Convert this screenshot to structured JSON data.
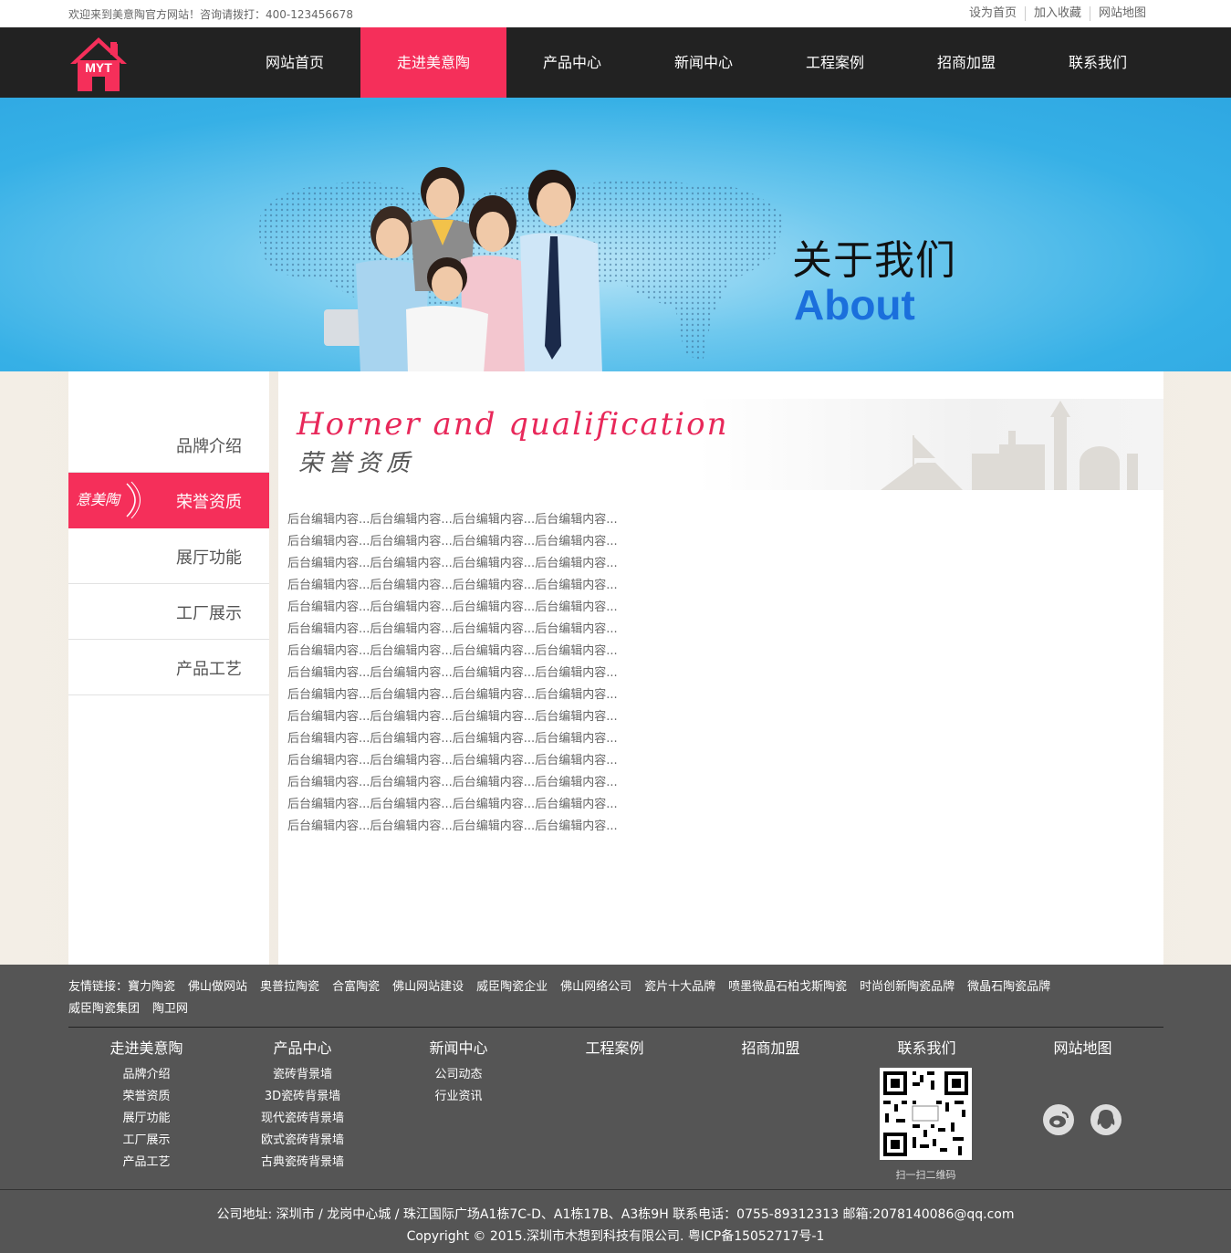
{
  "topbar": {
    "welcome": "欢迎来到美意陶官方网站！咨询请拨打：400-123456678",
    "links": [
      "设为首页",
      "加入收藏",
      "网站地图"
    ]
  },
  "header": {
    "logo_text": "MYT",
    "nav": [
      "网站首页",
      "走进美意陶",
      "产品中心",
      "新闻中心",
      "工程案例",
      "招商加盟",
      "联系我们"
    ],
    "active_index": 1,
    "accent_color": "#f52f5a"
  },
  "banner": {
    "title_cn": "关于我们",
    "title_en": "About"
  },
  "sidebar": {
    "items": [
      "品牌介绍",
      "荣誉资质",
      "展厅功能",
      "工厂展示",
      "产品工艺"
    ],
    "active_index": 1,
    "active_mark": "意美陶"
  },
  "main": {
    "heading_en": "Horner and qualification",
    "heading_cn": "荣誉资质",
    "lines": [
      "后台编辑内容...后台编辑内容...后台编辑内容...后台编辑内容...",
      "后台编辑内容...后台编辑内容...后台编辑内容...后台编辑内容...",
      "后台编辑内容...后台编辑内容...后台编辑内容...后台编辑内容...",
      "后台编辑内容...后台编辑内容...后台编辑内容...后台编辑内容...",
      "后台编辑内容...后台编辑内容...后台编辑内容...后台编辑内容...",
      "后台编辑内容...后台编辑内容...后台编辑内容...后台编辑内容...",
      "后台编辑内容...后台编辑内容...后台编辑内容...后台编辑内容...",
      "后台编辑内容...后台编辑内容...后台编辑内容...后台编辑内容...",
      "后台编辑内容...后台编辑内容...后台编辑内容...后台编辑内容...",
      "后台编辑内容...后台编辑内容...后台编辑内容...后台编辑内容...",
      "后台编辑内容...后台编辑内容...后台编辑内容...后台编辑内容...",
      "后台编辑内容...后台编辑内容...后台编辑内容...后台编辑内容...",
      "后台编辑内容...后台编辑内容...后台编辑内容...后台编辑内容...",
      "后台编辑内容...后台编辑内容...后台编辑内容...后台编辑内容...",
      "后台编辑内容...后台编辑内容...后台编辑内容...后台编辑内容..."
    ]
  },
  "footer": {
    "friend_label": "友情链接：",
    "friend_links": [
      "寶力陶瓷",
      "佛山做网站",
      "奥普拉陶瓷",
      "合富陶瓷",
      "佛山网站建设",
      "威臣陶瓷企业",
      "佛山网络公司",
      "瓷片十大品牌",
      "喷墨微晶石柏戈斯陶瓷",
      "时尚创新陶瓷品牌",
      "微晶石陶瓷品牌",
      "威臣陶瓷集团",
      "陶卫网"
    ],
    "columns": [
      {
        "title": "走进美意陶",
        "items": [
          "品牌介绍",
          "荣誉资质",
          "展厅功能",
          "工厂展示",
          "产品工艺"
        ]
      },
      {
        "title": "产品中心",
        "items": [
          "瓷砖背景墙",
          "3D瓷砖背景墙",
          "现代瓷砖背景墙",
          "欧式瓷砖背景墙",
          "古典瓷砖背景墙"
        ]
      },
      {
        "title": "新闻中心",
        "items": [
          "公司动态",
          "行业资讯"
        ]
      },
      {
        "title": "工程案例",
        "items": []
      },
      {
        "title": "招商加盟",
        "items": []
      },
      {
        "title": "联系我们",
        "items": []
      },
      {
        "title": "网站地图",
        "items": []
      }
    ],
    "qr_caption": "扫一扫二维码",
    "social_icons": [
      "weibo-icon",
      "qq-icon"
    ],
    "address_line": "公司地址: 深圳市 / 龙岗中心城 / 珠江国际广场A1栋7C-D、A1栋17B、A3栋9H 联系电话：0755-89312313 邮箱:2078140086@qq.com",
    "copyright_line": "Copyright © 2015.深圳市木想到科技有限公司. 粤ICP备15052717号-1"
  }
}
